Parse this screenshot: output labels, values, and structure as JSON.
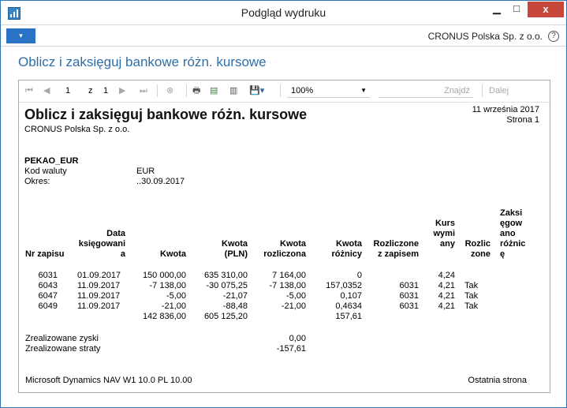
{
  "window": {
    "title": "Podgląd wydruku",
    "min_label": "▁",
    "max_label": "□",
    "close_label": "x"
  },
  "command_bar": {
    "menu_icon_label": "▾",
    "company": "CRONUS Polska Sp. z o.o.",
    "help_label": "?"
  },
  "page_heading": "Oblicz i zaksięguj bankowe różn. kursowe",
  "toolbar": {
    "page_current": "1",
    "page_of": "z",
    "page_total": "1",
    "zoom": "100%",
    "find_label": "Znajdź",
    "next_label": "Dalej"
  },
  "report": {
    "title": "Oblicz i zaksięguj bankowe różn. kursowe",
    "company": "CRONUS Polska Sp. z o.o.",
    "date": "11 września 2017",
    "page_label": "Strona 1",
    "bank_name": "PEKAO_EUR",
    "fields": [
      {
        "label": "Kod waluty",
        "value": "EUR"
      },
      {
        "label": "Okres:",
        "value": "..30.09.2017"
      }
    ],
    "columns": [
      "Nr zapisu",
      "Data\nksięgowani\na",
      "Kwota",
      "Kwota\n(PLN)",
      "Kwota\nrozliczona",
      "Kwota\nróżnicy",
      "Rozliczone\nz zapisem",
      "Kurs\nwymi\nany",
      "Rozlic\nzone",
      "Zaksi\nęgow\nano\nróżnic\nę"
    ],
    "rows": [
      [
        "6031",
        "01.09.2017",
        "150 000,00",
        "635 310,00",
        "7 164,00",
        "0",
        "",
        "4,24",
        ""
      ],
      [
        "6043",
        "11.09.2017",
        "-7 138,00",
        "-30 075,25",
        "-7 138,00",
        "157,0352",
        "6031",
        "4,21",
        "Tak"
      ],
      [
        "6047",
        "11.09.2017",
        "-5,00",
        "-21,07",
        "-5,00",
        "0,107",
        "6031",
        "4,21",
        "Tak"
      ],
      [
        "6049",
        "11.09.2017",
        "-21,00",
        "-88,48",
        "-21,00",
        "0,4634",
        "6031",
        "4,21",
        "Tak"
      ]
    ],
    "totals": {
      "kwota": "142 836,00",
      "kwota_pln": "605 125,20",
      "kwota_roznicy": "157,61"
    },
    "realized": [
      {
        "label": "Zrealizowane zyski",
        "value": "0,00"
      },
      {
        "label": "Zrealizowane straty",
        "value": "-157,61"
      }
    ],
    "footer_left": "Microsoft Dynamics NAV W1 10.0  PL 10.00",
    "footer_right": "Ostatnia strona"
  }
}
